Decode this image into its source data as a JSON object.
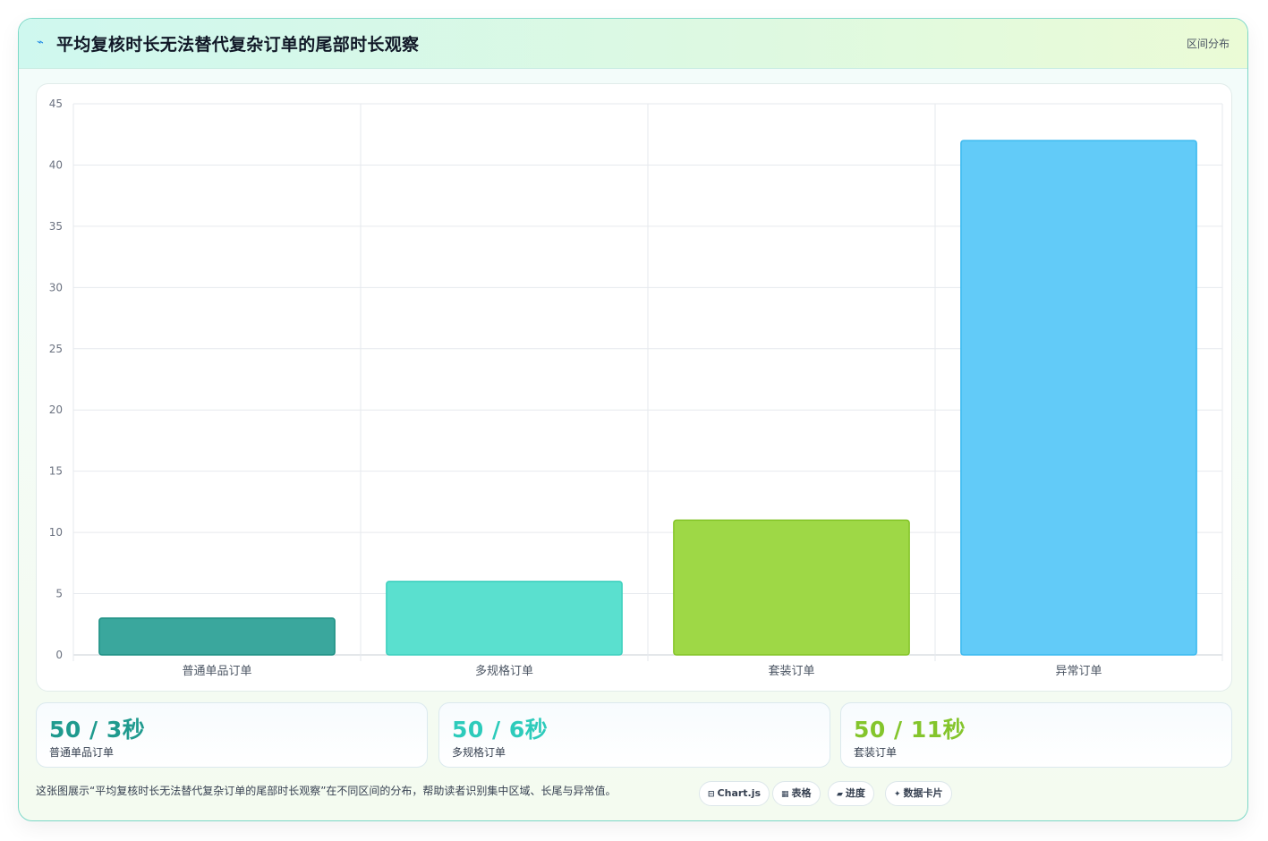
{
  "header": {
    "title": "平均复核时长无法替代复杂订单的尾部时长观察",
    "tag": "区间分布"
  },
  "chart_data": {
    "type": "bar",
    "categories": [
      "普通单品订单",
      "多规格订单",
      "套装订单",
      "异常订单"
    ],
    "values": [
      3,
      6,
      11,
      42
    ],
    "ylim": [
      0,
      45
    ],
    "yticks": [
      0,
      5,
      10,
      15,
      20,
      25,
      30,
      35,
      40,
      45
    ],
    "grid": true,
    "legend": "none",
    "colors": [
      "#3aa79d",
      "#5ae0cf",
      "#9ed846",
      "#62cbf8"
    ],
    "border_colors": [
      "#1c8f83",
      "#3ccfbd",
      "#84c427",
      "#3bb9ef"
    ]
  },
  "stats": [
    {
      "value": "50 / 3秒",
      "label": "普通单品订单",
      "color": "#1f9a8e"
    },
    {
      "value": "50 / 6秒",
      "label": "多规格订单",
      "color": "#2dcbbb"
    },
    {
      "value": "50 / 11秒",
      "label": "套装订单",
      "color": "#84c52c"
    }
  ],
  "footer": {
    "note": "这张图展示“平均复核时长无法替代复杂订单的尾部时长观察”在不同区间的分布，帮助读者识别集中区域、长尾与异常值。"
  },
  "pills": [
    {
      "icon": "⊟",
      "label": "Chart.js",
      "icon_name": "chart-icon"
    },
    {
      "icon": "▦",
      "label": "表格",
      "icon_name": "table-icon"
    },
    {
      "icon": "▰",
      "label": "进度",
      "icon_name": "progress-icon"
    },
    {
      "icon": "✦",
      "label": "数据卡片",
      "icon_name": "sparkle-icon"
    }
  ]
}
